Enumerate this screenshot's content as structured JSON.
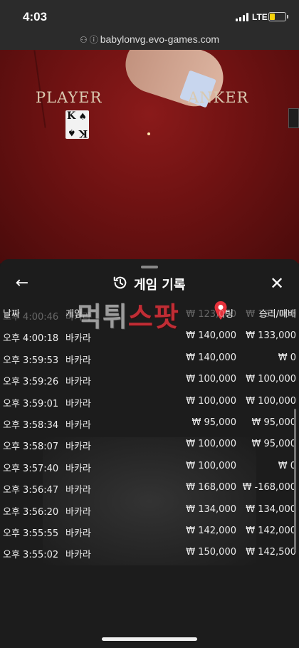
{
  "status_bar": {
    "time": "4:03",
    "network": "LTE",
    "battery_color": "#f5d20a"
  },
  "browser": {
    "url": "babylonvg.evo-games.com",
    "icons": [
      "people-icon",
      "info-icon"
    ]
  },
  "video": {
    "player_label": "PLAYER",
    "banker_label": "ANKER",
    "card_rank": "K",
    "card_suit": "♠",
    "felt_color": "#7a1515"
  },
  "sheet": {
    "title": "게임 기록",
    "back_icon": "arrow-left-icon",
    "title_icon": "history-icon",
    "close_icon": "close-icon",
    "columns": {
      "date": "날짜",
      "game": "게임",
      "bet": "베팅",
      "result": "승리/패배"
    },
    "watermark": {
      "part1": "먹튀",
      "part2": "스팟"
    },
    "rows": [
      {
        "time": "오후 4:00:46",
        "game": "바카라",
        "bet": "₩ 123,000",
        "result": "₩ 123,000"
      },
      {
        "time": "오후 4:00:18",
        "game": "바카라",
        "bet": "₩ 140,000",
        "result": "₩ 133,000"
      },
      {
        "time": "오후 3:59:53",
        "game": "바카라",
        "bet": "₩ 140,000",
        "result": "₩ 0"
      },
      {
        "time": "오후 3:59:26",
        "game": "바카라",
        "bet": "₩ 100,000",
        "result": "₩ 100,000"
      },
      {
        "time": "오후 3:59:01",
        "game": "바카라",
        "bet": "₩ 100,000",
        "result": "₩ 100,000"
      },
      {
        "time": "오후 3:58:34",
        "game": "바카라",
        "bet": "₩ 95,000",
        "result": "₩ 95,000"
      },
      {
        "time": "오후 3:58:07",
        "game": "바카라",
        "bet": "₩ 100,000",
        "result": "₩ 95,000"
      },
      {
        "time": "오후 3:57:40",
        "game": "바카라",
        "bet": "₩ 100,000",
        "result": "₩ 0"
      },
      {
        "time": "오후 3:56:47",
        "game": "바카라",
        "bet": "₩ 168,000",
        "result": "₩ -168,000"
      },
      {
        "time": "오후 3:56:20",
        "game": "바카라",
        "bet": "₩ 134,000",
        "result": "₩ 134,000"
      },
      {
        "time": "오후 3:55:55",
        "game": "바카라",
        "bet": "₩ 142,000",
        "result": "₩ 142,000"
      },
      {
        "time": "오후 3:55:02",
        "game": "바카라",
        "bet": "₩ 150,000",
        "result": "₩ 142,500"
      }
    ]
  }
}
